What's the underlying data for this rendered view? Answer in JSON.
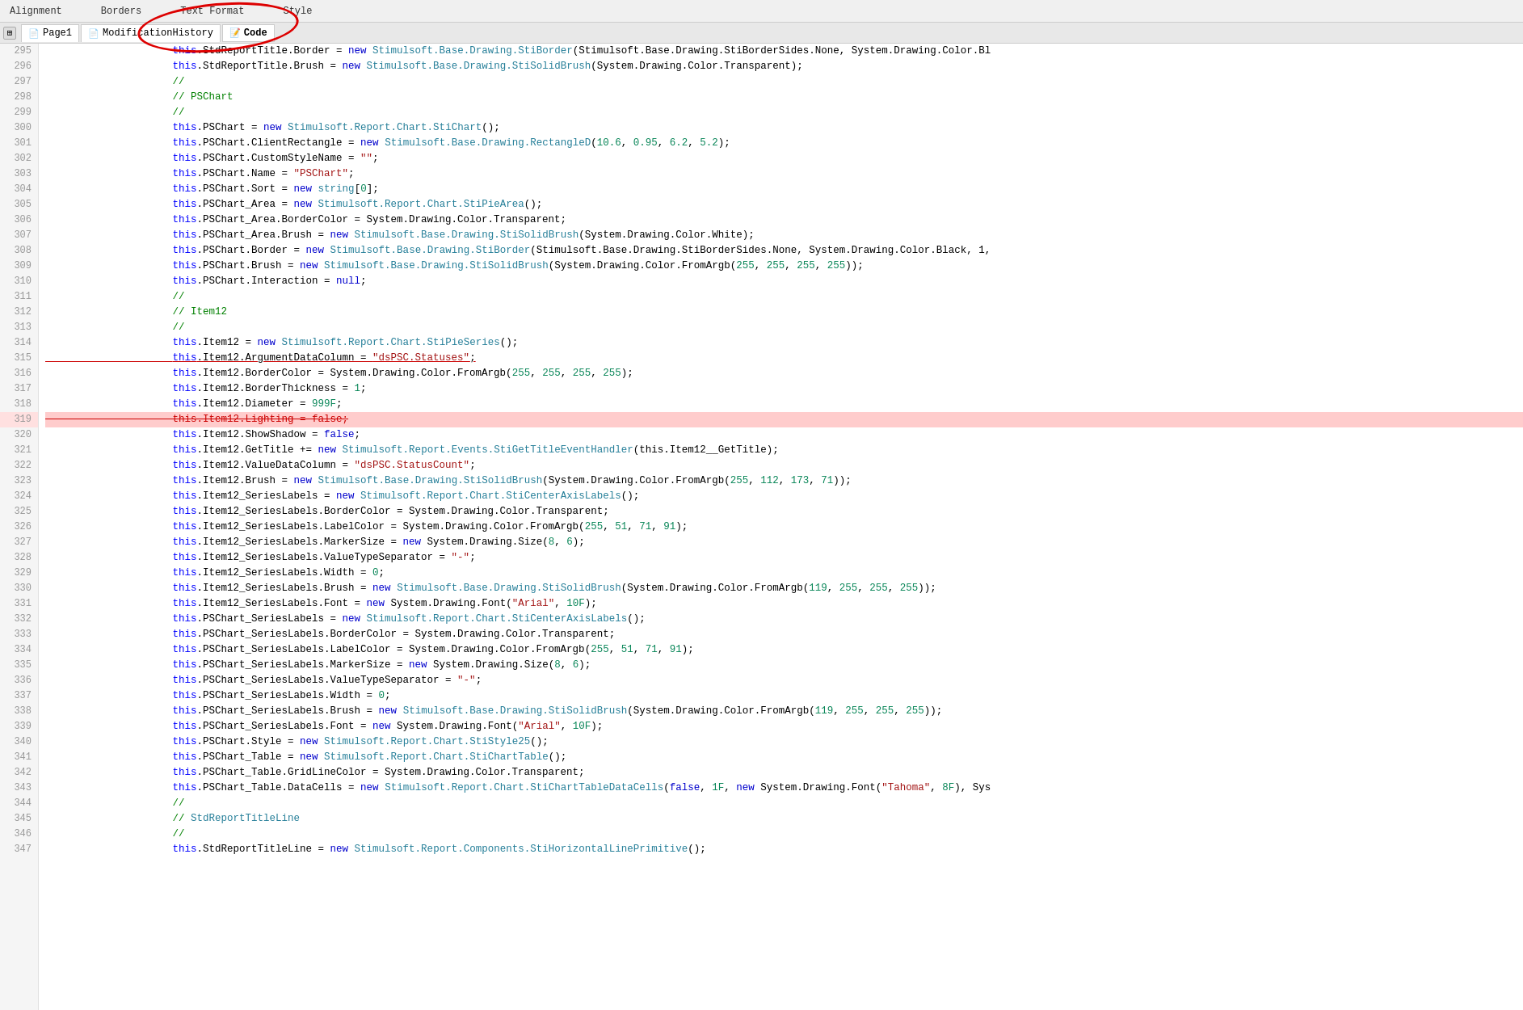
{
  "toolbar": {
    "items": [
      "Alignment",
      "Borders",
      "Text Format",
      "Style"
    ]
  },
  "tabs": [
    {
      "id": "pin",
      "label": ""
    },
    {
      "id": "page1",
      "label": "Page1",
      "icon": "page"
    },
    {
      "id": "modhistory",
      "label": "ModificationHistory",
      "icon": "page"
    },
    {
      "id": "code",
      "label": "Code",
      "icon": "code",
      "active": true
    }
  ],
  "lines": [
    {
      "num": 295,
      "content": "this.StdReportTitle.Border = new Stimulsoft.Base.Drawing.StiBorder(Stimulsoft.Base.Drawing.StiBorderSides.None, System.Drawing.Color.Bl"
    },
    {
      "num": 296,
      "content": "this.StdReportTitle.Brush = new Stimulsoft.Base.Drawing.StiSolidBrush(System.Drawing.Color.Transparent);"
    },
    {
      "num": 297,
      "content": "//"
    },
    {
      "num": 298,
      "content": "// PSChart"
    },
    {
      "num": 299,
      "content": "//"
    },
    {
      "num": 300,
      "content": "this.PSChart = new Stimulsoft.Report.Chart.StiChart();"
    },
    {
      "num": 301,
      "content": "this.PSChart.ClientRectangle = new Stimulsoft.Base.Drawing.RectangleD(10.6, 0.95, 6.2, 5.2);"
    },
    {
      "num": 302,
      "content": "this.PSChart.CustomStyleName = \"\";"
    },
    {
      "num": 303,
      "content": "this.PSChart.Name = \"PSChart\";"
    },
    {
      "num": 304,
      "content": "this.PSChart.Sort = new string[0];"
    },
    {
      "num": 305,
      "content": "this.PSChart_Area = new Stimulsoft.Report.Chart.StiPieArea();"
    },
    {
      "num": 306,
      "content": "this.PSChart_Area.BorderColor = System.Drawing.Color.Transparent;"
    },
    {
      "num": 307,
      "content": "this.PSChart_Area.Brush = new Stimulsoft.Base.Drawing.StiSolidBrush(System.Drawing.Color.White);"
    },
    {
      "num": 308,
      "content": "this.PSChart.Border = new Stimulsoft.Base.Drawing.StiBorder(Stimulsoft.Base.Drawing.StiBorderSides.None, System.Drawing.Color.Black, 1,"
    },
    {
      "num": 309,
      "content": "this.PSChart.Brush = new Stimulsoft.Base.Drawing.StiSolidBrush(System.Drawing.Color.FromArgb(255, 255, 255, 255));"
    },
    {
      "num": 310,
      "content": "this.PSChart.Interaction = null;"
    },
    {
      "num": 311,
      "content": "//"
    },
    {
      "num": 312,
      "content": "// Item12"
    },
    {
      "num": 313,
      "content": "//"
    },
    {
      "num": 314,
      "content": "this.Item12 = new Stimulsoft.Report.Chart.StiPieSeries();"
    },
    {
      "num": 315,
      "content": "this.Item12.ArgumentDataColumn = \"dsPSC.Statuses\";",
      "underline": true
    },
    {
      "num": 316,
      "content": "this.Item12.BorderColor = System.Drawing.Color.FromArgb(255, 255, 255, 255);"
    },
    {
      "num": 317,
      "content": "this.Item12.BorderThickness = 1;"
    },
    {
      "num": 318,
      "content": "this.Item12.Diameter = 999F;"
    },
    {
      "num": 319,
      "content": "this.Item12.Lighting = false;",
      "strikethrough": true,
      "bg_red": true
    },
    {
      "num": 320,
      "content": "this.Item12.ShowShadow = false;"
    },
    {
      "num": 321,
      "content": "this.Item12.GetTitle += new Stimulsoft.Report.Events.StiGetTitleEventHandler(this.Item12__GetTitle);"
    },
    {
      "num": 322,
      "content": "this.Item12.ValueDataColumn = \"dsPSC.StatusCount\";"
    },
    {
      "num": 323,
      "content": "this.Item12.Brush = new Stimulsoft.Base.Drawing.StiSolidBrush(System.Drawing.Color.FromArgb(255, 112, 173, 71));"
    },
    {
      "num": 324,
      "content": "this.Item12_SeriesLabels = new Stimulsoft.Report.Chart.StiCenterAxisLabels();"
    },
    {
      "num": 325,
      "content": "this.Item12_SeriesLabels.BorderColor = System.Drawing.Color.Transparent;"
    },
    {
      "num": 326,
      "content": "this.Item12_SeriesLabels.LabelColor = System.Drawing.Color.FromArgb(255, 51, 71, 91);"
    },
    {
      "num": 327,
      "content": "this.Item12_SeriesLabels.MarkerSize = new System.Drawing.Size(8, 6);"
    },
    {
      "num": 328,
      "content": "this.Item12_SeriesLabels.ValueTypeSeparator = \"-\";"
    },
    {
      "num": 329,
      "content": "this.Item12_SeriesLabels.Width = 0;"
    },
    {
      "num": 330,
      "content": "this.Item12_SeriesLabels.Brush = new Stimulsoft.Base.Drawing.StiSolidBrush(System.Drawing.Color.FromArgb(119, 255, 255, 255));"
    },
    {
      "num": 331,
      "content": "this.Item12_SeriesLabels.Font = new System.Drawing.Font(\"Arial\", 10F);"
    },
    {
      "num": 332,
      "content": "this.PSChart_SeriesLabels = new Stimulsoft.Report.Chart.StiCenterAxisLabels();"
    },
    {
      "num": 333,
      "content": "this.PSChart_SeriesLabels.BorderColor = System.Drawing.Color.Transparent;"
    },
    {
      "num": 334,
      "content": "this.PSChart_SeriesLabels.LabelColor = System.Drawing.Color.FromArgb(255, 51, 71, 91);"
    },
    {
      "num": 335,
      "content": "this.PSChart_SeriesLabels.MarkerSize = new System.Drawing.Size(8, 6);"
    },
    {
      "num": 336,
      "content": "this.PSChart_SeriesLabels.ValueTypeSeparator = \"-\";"
    },
    {
      "num": 337,
      "content": "this.PSChart_SeriesLabels.Width = 0;"
    },
    {
      "num": 338,
      "content": "this.PSChart_SeriesLabels.Brush = new Stimulsoft.Base.Drawing.StiSolidBrush(System.Drawing.Color.FromArgb(119, 255, 255, 255));"
    },
    {
      "num": 339,
      "content": "this.PSChart_SeriesLabels.Font = new System.Drawing.Font(\"Arial\", 10F);"
    },
    {
      "num": 340,
      "content": "this.PSChart.Style = new Stimulsoft.Report.Chart.StiStyle25();"
    },
    {
      "num": 341,
      "content": "this.PSChart_Table = new Stimulsoft.Report.Chart.StiChartTable();"
    },
    {
      "num": 342,
      "content": "this.PSChart_Table.GridLineColor = System.Drawing.Color.Transparent;"
    },
    {
      "num": 343,
      "content": "this.PSChart_Table.DataCells = new Stimulsoft.Report.Chart.StiChartTableDataCells(false, 1F, new System.Drawing.Font(\"Tahoma\", 8F), Sys"
    },
    {
      "num": 344,
      "content": "//"
    },
    {
      "num": 345,
      "content": "// StdReportTitleLine"
    },
    {
      "num": 346,
      "content": "//"
    },
    {
      "num": 347,
      "content": "this.StdReportTitleLine = new Stimulsoft.Report.Components.StiHorizontalLinePrimitive();"
    }
  ]
}
